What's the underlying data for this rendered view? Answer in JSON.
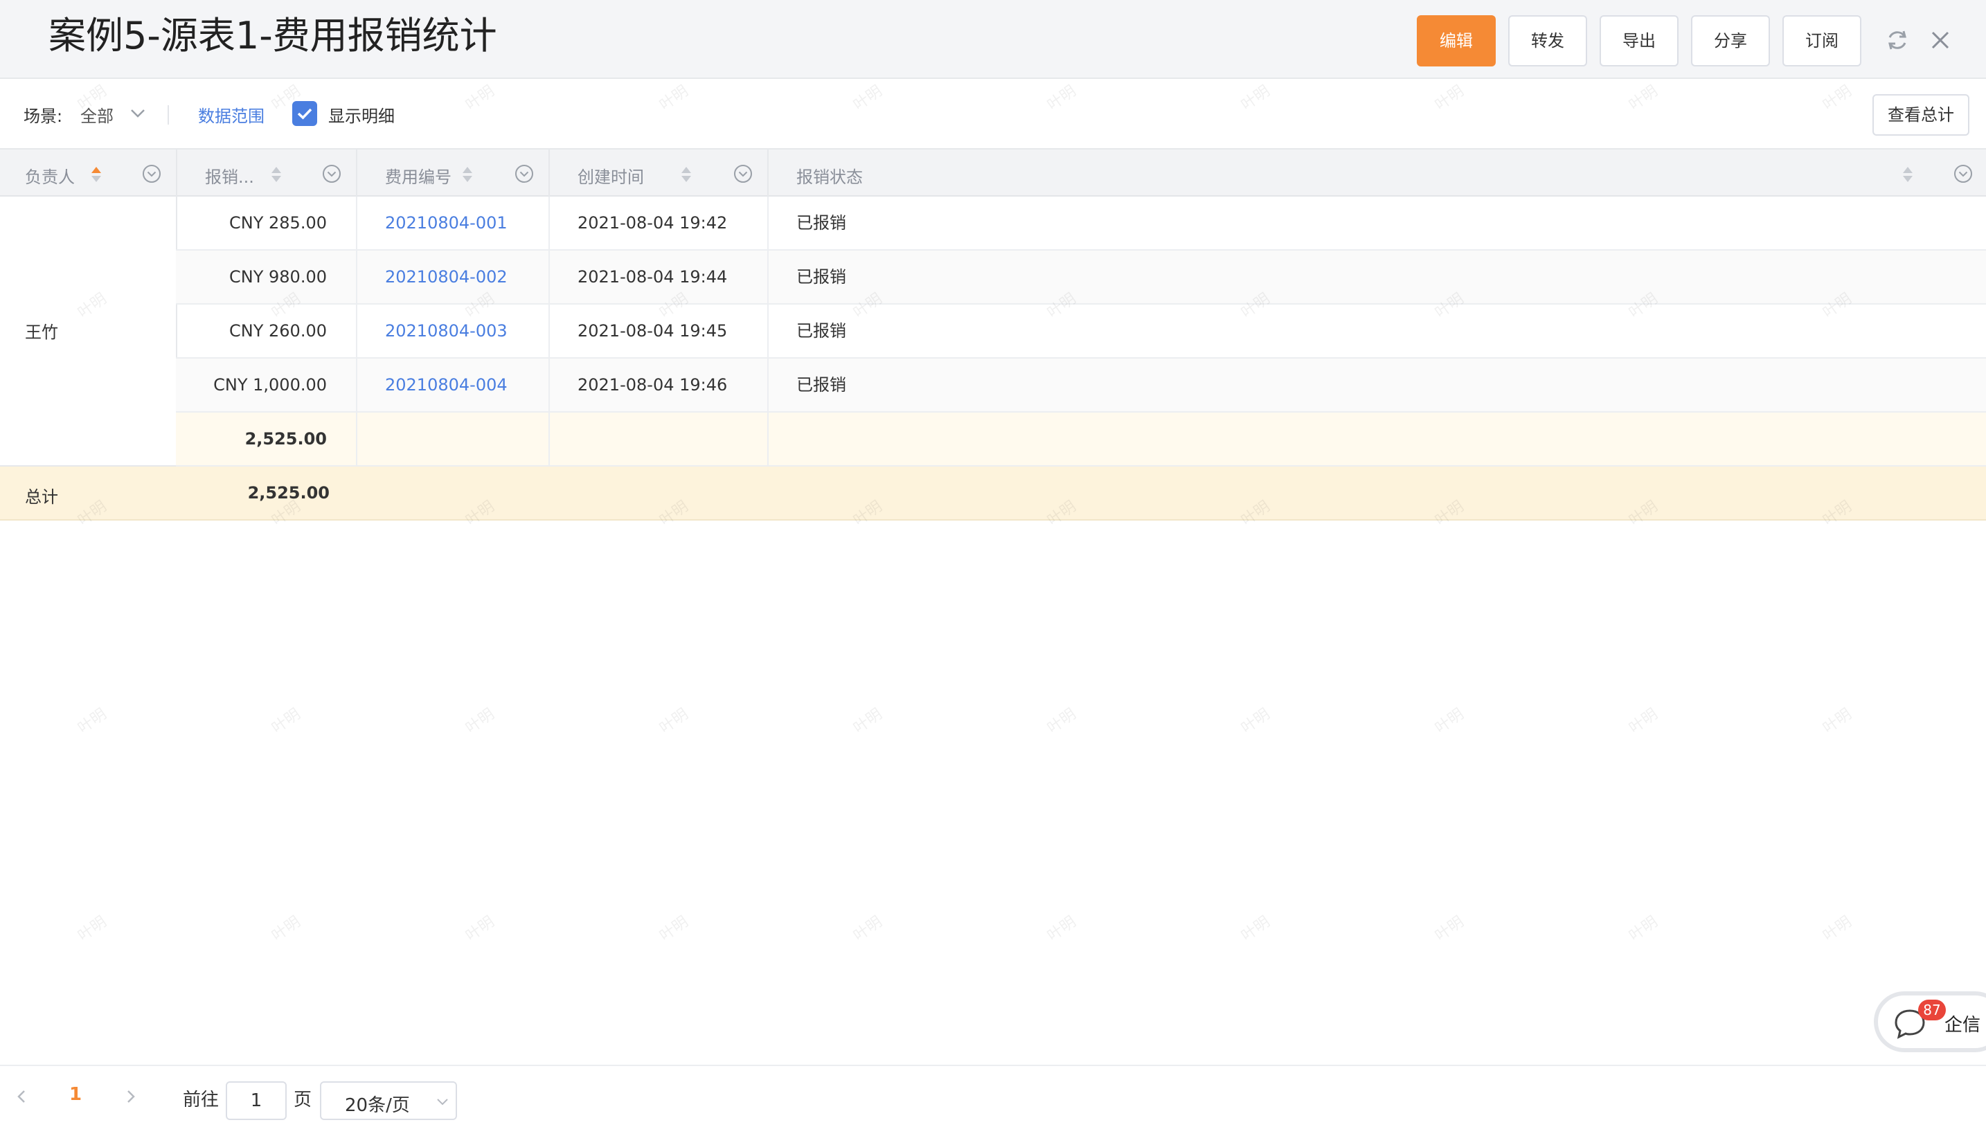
{
  "header": {
    "title": "案例5-源表1-费用报销统计",
    "buttons": {
      "edit": "编辑",
      "forward": "转发",
      "export": "导出",
      "share": "分享",
      "subscribe": "订阅"
    },
    "accent_color": "#f58a35"
  },
  "toolbar": {
    "scene_label": "场景:",
    "scene_value": "全部",
    "data_range": "数据范围",
    "show_detail": "显示明细",
    "show_detail_checked": true,
    "view_total": "查看总计"
  },
  "table": {
    "columns": [
      "负责人",
      "报销...",
      "费用编号",
      "创建时间",
      "报销状态"
    ],
    "owner": "王竹",
    "rows": [
      {
        "amount": "CNY 285.00",
        "code": "20210804-001",
        "time": "2021-08-04 19:42",
        "status": "已报销"
      },
      {
        "amount": "CNY 980.00",
        "code": "20210804-002",
        "time": "2021-08-04 19:44",
        "status": "已报销"
      },
      {
        "amount": "CNY 260.00",
        "code": "20210804-003",
        "time": "2021-08-04 19:45",
        "status": "已报销"
      },
      {
        "amount": "CNY 1,000.00",
        "code": "20210804-004",
        "time": "2021-08-04 19:46",
        "status": "已报销"
      }
    ],
    "subtotal": "2,525.00",
    "total_label": "总计",
    "total": "2,525.00"
  },
  "watermark": "叶明",
  "pager": {
    "current": "1",
    "goto_label": "前往",
    "page_input": "1",
    "page_unit": "页",
    "page_size": "20条/页"
  },
  "chat": {
    "label": "企信",
    "badge": "87"
  }
}
